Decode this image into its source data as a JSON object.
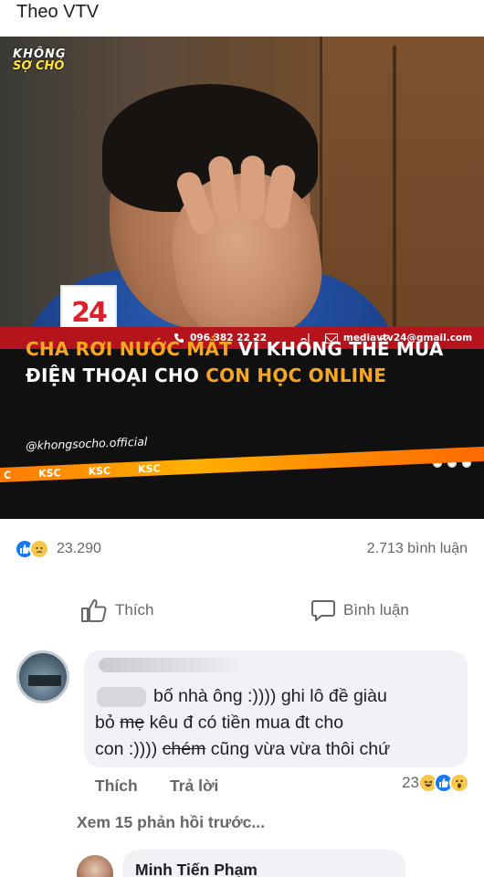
{
  "post": {
    "source": "Theo VTV"
  },
  "media": {
    "logo_line1": "KHÔNG",
    "logo_line2": "SỢ CHÓ",
    "channel_logo": "24",
    "phone": "096 382 22 22",
    "separator": "|",
    "email": "mediavtv24@gmail.com",
    "headline": {
      "part1": "CHA RƠI NƯỚC MẮT",
      "part2": " VÌ KHÔNG THỂ MUA ĐIỆN THOẠI CHO ",
      "part3": "CON HỌC ONLINE"
    },
    "handle": "@khongsocho.official",
    "ticker": [
      "C",
      "KSC",
      "KSC",
      "KSC"
    ]
  },
  "stats": {
    "reaction_count": "23.290",
    "comment_count": "2.713 bình luận",
    "reaction_icons": [
      "like-icon",
      "sad-icon"
    ]
  },
  "actions": {
    "like_label": "Thích",
    "comment_label": "Bình luận"
  },
  "comment": {
    "line1": "bố nhà ông :)))) ghi lô đề giàu",
    "line2_pre": "bỏ ",
    "line2_strike": "mẹ",
    "line2_post": " kêu đ có tiền mua đt cho",
    "line3_pre": "con :)))) ",
    "line3_strike": "chém",
    "line3_post": " cũng vừa vừa thôi chứ",
    "like_label": "Thích",
    "reply_label": "Trả lời",
    "reaction_count": "23",
    "reaction_icons": [
      "haha-icon",
      "like-icon",
      "wow-icon"
    ]
  },
  "replies": {
    "more_label": "Xem 15 phản hồi trước...",
    "first_name": "Minh Tiến Phạm"
  },
  "colors": {
    "like_blue": "#1877f2",
    "headline_orange": "#f6a623",
    "vtv_red": "#b5141c",
    "meta_gray": "#65676b"
  }
}
